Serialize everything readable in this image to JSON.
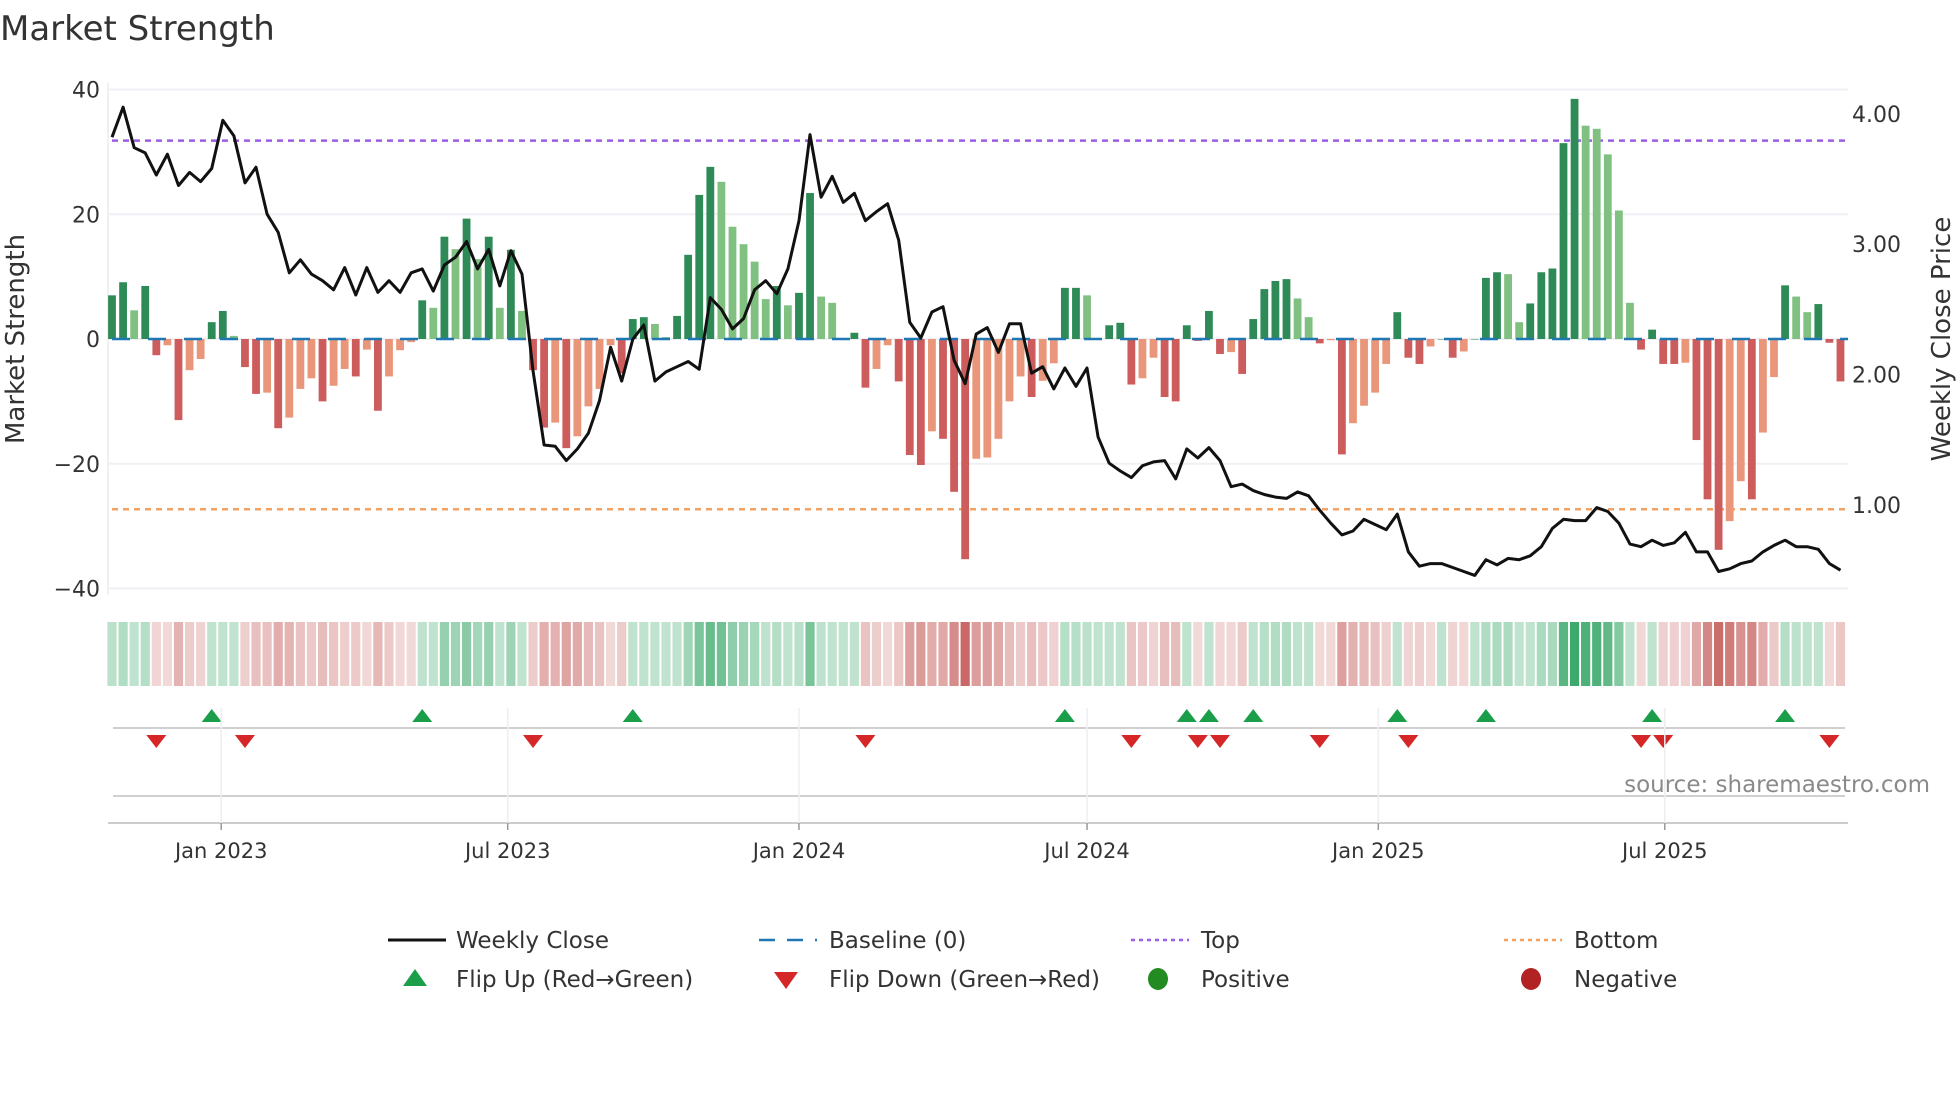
{
  "chart_data": {
    "type": "bar",
    "title": "Market Strength",
    "ylabel": "Market Strength",
    "y2label": "Weekly Close Price",
    "ylim": [
      -40,
      40
    ],
    "y2lim": [
      0.43,
      4.27
    ],
    "yticks": [
      "40",
      "20",
      "0",
      "−20",
      "−40"
    ],
    "ytick_values": [
      40,
      20,
      0,
      -20,
      -40
    ],
    "y2ticks": [
      "4.00",
      "3.00",
      "2.00",
      "1.00"
    ],
    "y2tick_values": [
      4,
      3,
      2,
      1
    ],
    "start_week": "2022-10-24",
    "interval_days": 7,
    "xticks": [
      {
        "label": "Jan 2023",
        "date": "2023-01-01"
      },
      {
        "label": "Jul 2023",
        "date": "2023-07-01"
      },
      {
        "label": "Jan 2024",
        "date": "2024-01-01"
      },
      {
        "label": "Jul 2024",
        "date": "2024-07-01"
      },
      {
        "label": "Jan 2025",
        "date": "2025-01-01"
      },
      {
        "label": "Jul 2025",
        "date": "2025-07-01"
      }
    ],
    "top_level": 31.8,
    "bottom_level": -27.3,
    "baseline": 0,
    "strength": [
      7,
      9.1,
      4.6,
      8.5,
      -2.6,
      -1,
      -13,
      -5,
      -3.2,
      2.7,
      4.5,
      0.5,
      -4.5,
      -8.8,
      -8.6,
      -14.3,
      -12.6,
      -8,
      -6.3,
      -10,
      -7.5,
      -4.8,
      -6,
      -1.7,
      -11.5,
      -6,
      -1.8,
      -0.5,
      6.2,
      5,
      16.4,
      14.4,
      19.3,
      12.8,
      16.4,
      5,
      14.3,
      4.5,
      -5,
      -14.2,
      -13.4,
      -17.5,
      -15.6,
      -10.8,
      -8,
      -1,
      -5.5,
      3.2,
      3.5,
      2.4,
      0.3,
      3.7,
      13.5,
      23.1,
      27.6,
      25.2,
      18,
      15.2,
      12.4,
      6.4,
      8.5,
      5.4,
      7.4,
      23.4,
      6.8,
      5.8,
      0,
      1,
      -7.8,
      -4.8,
      -1,
      -6.8,
      -18.6,
      -20.2,
      -14.8,
      -16,
      -24.5,
      -35.3,
      -19.2,
      -19,
      -16,
      -10,
      -6,
      -9.3,
      -6.7,
      -3.9,
      8.2,
      8.2,
      7,
      0,
      2.2,
      2.6,
      -7.3,
      -6.3,
      -3,
      -9.3,
      -10,
      2.2,
      -0.3,
      4.5,
      -2.4,
      -2.1,
      -5.6,
      3.2,
      8,
      9.3,
      9.6,
      6.5,
      3.5,
      -0.7,
      -0.2,
      -18.5,
      -13.5,
      -10.7,
      -8.6,
      -4,
      4.3,
      -3,
      -4,
      -1.2,
      0,
      -3,
      -2,
      0,
      9.8,
      10.7,
      10.4,
      2.7,
      5.7,
      10.7,
      11.3,
      31.4,
      38.5,
      34.2,
      33.7,
      29.6,
      20.6,
      5.8,
      -1.7,
      1.5,
      -4,
      -4,
      -3.8,
      -16.2,
      -25.7,
      -33.8,
      -29.2,
      -22.8,
      -25.7,
      -15,
      -6.1,
      8.6,
      6.8,
      4.3,
      5.6,
      -0.6,
      -6.8
    ],
    "weekly_close": [
      3.82,
      4.05,
      3.74,
      3.7,
      3.53,
      3.69,
      3.45,
      3.55,
      3.48,
      3.58,
      3.95,
      3.83,
      3.47,
      3.59,
      3.23,
      3.09,
      2.78,
      2.88,
      2.77,
      2.72,
      2.65,
      2.82,
      2.61,
      2.82,
      2.63,
      2.72,
      2.63,
      2.78,
      2.81,
      2.64,
      2.84,
      2.9,
      3.02,
      2.81,
      2.96,
      2.68,
      2.95,
      2.77,
      2.03,
      1.46,
      1.45,
      1.34,
      1.43,
      1.55,
      1.8,
      2.21,
      1.95,
      2.27,
      2.38,
      1.95,
      2.02,
      2.06,
      2.1,
      2.04,
      2.59,
      2.5,
      2.35,
      2.43,
      2.65,
      2.72,
      2.62,
      2.81,
      3.18,
      3.84,
      3.36,
      3.52,
      3.32,
      3.39,
      3.18,
      3.25,
      3.31,
      3.03,
      2.4,
      2.28,
      2.48,
      2.52,
      2.11,
      1.93,
      2.31,
      2.36,
      2.17,
      2.39,
      2.39,
      2.01,
      2.06,
      1.89,
      2.05,
      1.91,
      2.05,
      1.52,
      1.32,
      1.26,
      1.21,
      1.3,
      1.33,
      1.34,
      1.2,
      1.43,
      1.36,
      1.44,
      1.34,
      1.14,
      1.16,
      1.11,
      1.08,
      1.06,
      1.05,
      1.1,
      1.07,
      0.96,
      0.86,
      0.77,
      0.8,
      0.89,
      0.85,
      0.81,
      0.93,
      0.64,
      0.53,
      0.55,
      0.55,
      0.52,
      0.49,
      0.46,
      0.58,
      0.54,
      0.59,
      0.58,
      0.61,
      0.68,
      0.82,
      0.89,
      0.88,
      0.88,
      0.98,
      0.95,
      0.86,
      0.7,
      0.68,
      0.73,
      0.69,
      0.71,
      0.79,
      0.64,
      0.64,
      0.49,
      0.51,
      0.55,
      0.57,
      0.64,
      0.69,
      0.73,
      0.68,
      0.68,
      0.66,
      0.55,
      0.5
    ],
    "legend": [
      {
        "label": "Weekly Close",
        "kind": "line",
        "color": "#111111"
      },
      {
        "label": "Baseline (0)",
        "kind": "dash",
        "color": "#1f77b4"
      },
      {
        "label": "Top",
        "kind": "dot",
        "color": "#9b5de5"
      },
      {
        "label": "Bottom",
        "kind": "dot",
        "color": "#f4a261"
      },
      {
        "label": "Flip Up (Red→Green)",
        "kind": "tri-up",
        "color": "#1a9e4a"
      },
      {
        "label": "Flip Down (Green→Red)",
        "kind": "tri-down",
        "color": "#d62728"
      },
      {
        "label": "Positive",
        "kind": "dot-marker",
        "color": "#228b22"
      },
      {
        "label": "Negative",
        "kind": "dot-marker",
        "color": "#b22222"
      }
    ],
    "legend_placement": "bottom",
    "colors": {
      "pos_strong": "#2e8b57",
      "pos_weak": "#80c080",
      "neg_strong": "#cd5c5c",
      "neg_weak": "#e9967a",
      "grid": "#eef0f3"
    },
    "source": "source: sharemaestro.com"
  }
}
